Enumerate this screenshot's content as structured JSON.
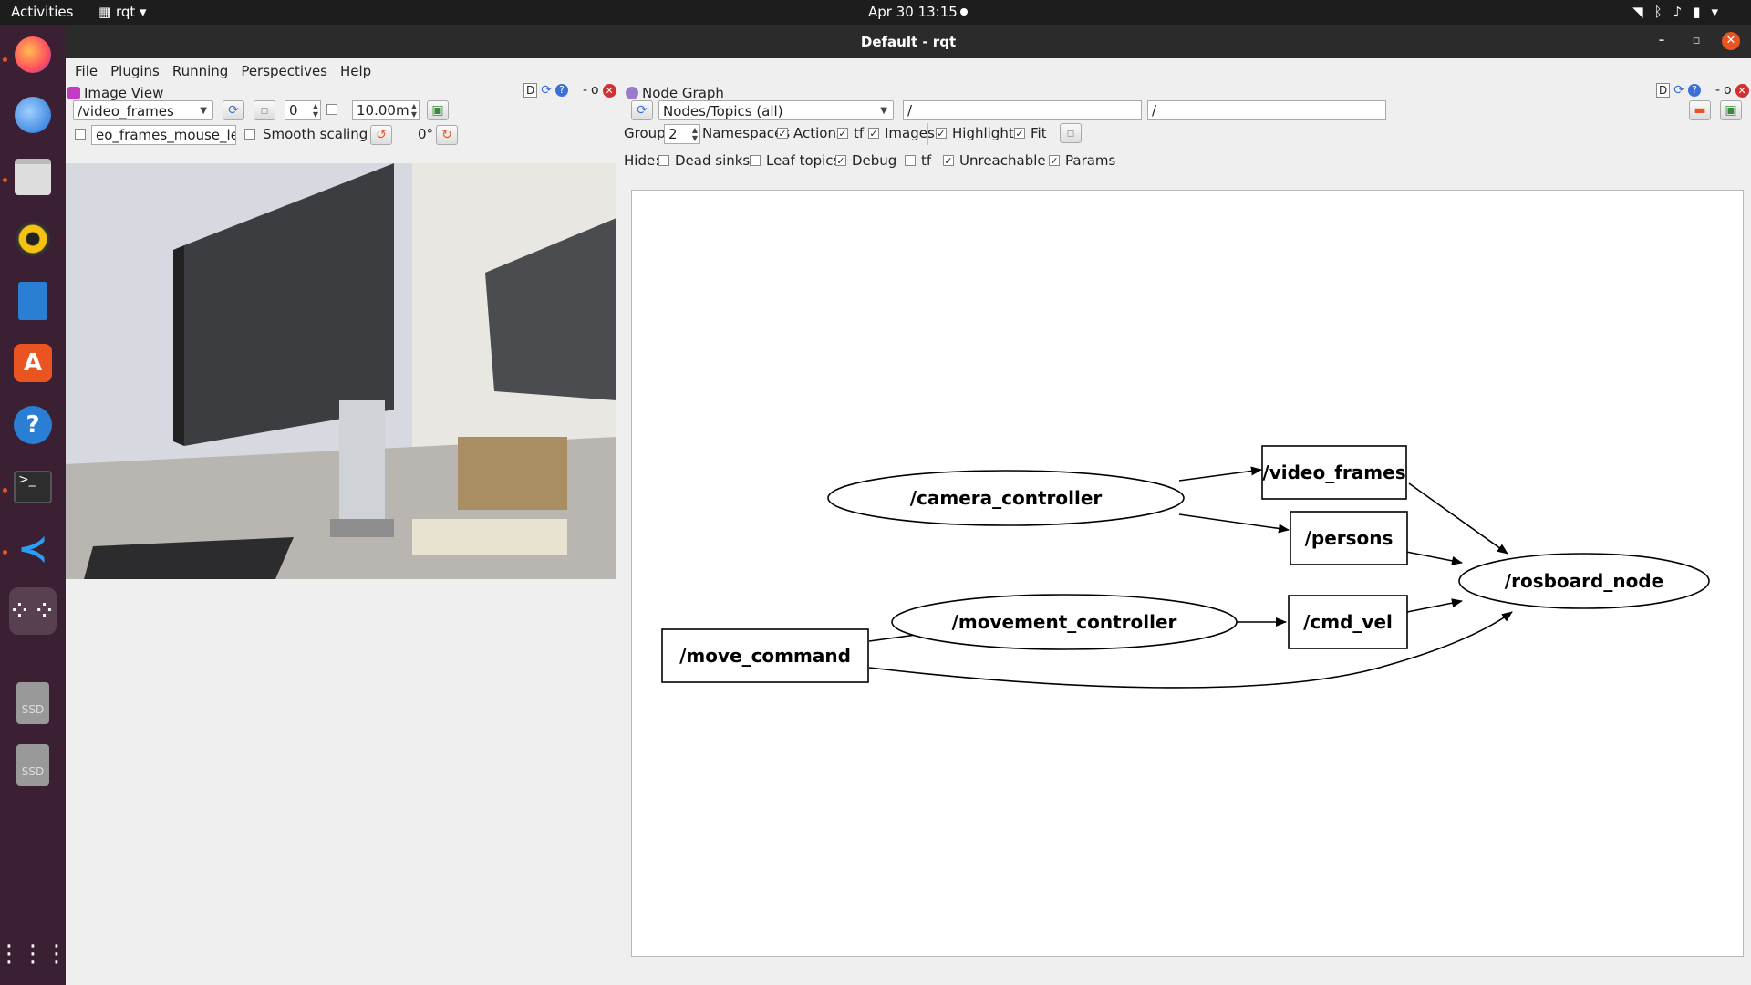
{
  "topbar": {
    "activities": "Activities",
    "app": "rqt",
    "clock": "Apr 30  13:15"
  },
  "window": {
    "title": "Default - rqt",
    "menu": [
      "File",
      "Plugins",
      "Running",
      "Perspectives",
      "Help"
    ]
  },
  "image_view": {
    "title": "Image View",
    "topic": "/video_frames",
    "spin_value": "0",
    "time_value": "10.00m",
    "mouse_topic": "eo_frames_mouse_left",
    "smooth_scaling": "Smooth scaling",
    "rotation": "0°"
  },
  "node_graph": {
    "title": "Node Graph",
    "mode": "Nodes/Topics (all)",
    "filter1": "/",
    "filter2": "/",
    "group_label": "Group:",
    "group_value": "2",
    "namespaces": "Namespaces",
    "actions": "Actions",
    "tf": "tf",
    "images": "Images",
    "highlight": "Highlight",
    "fit": "Fit",
    "hide_label": "Hide:",
    "dead_sinks": "Dead sinks",
    "leaf_topics": "Leaf topics",
    "debug": "Debug",
    "tf2": "tf",
    "unreachable": "Unreachable",
    "params": "Params",
    "checks": {
      "actions": true,
      "tf": true,
      "images": true,
      "highlight": true,
      "fit": true,
      "dead_sinks": false,
      "leaf_topics": false,
      "debug": true,
      "tf2": false,
      "unreachable": true,
      "params": true
    }
  },
  "graph": {
    "nodes": {
      "video_frames": "/video_frames",
      "camera_controller": "/camera_controller",
      "persons": "/persons",
      "rosboard_node": "/rosboard_node",
      "movement_controller": "/movement_controller",
      "cmd_vel": "/cmd_vel",
      "move_command": "/move_command"
    }
  },
  "dock": {
    "ssd1": "SSD",
    "ssd2": "SSD"
  }
}
